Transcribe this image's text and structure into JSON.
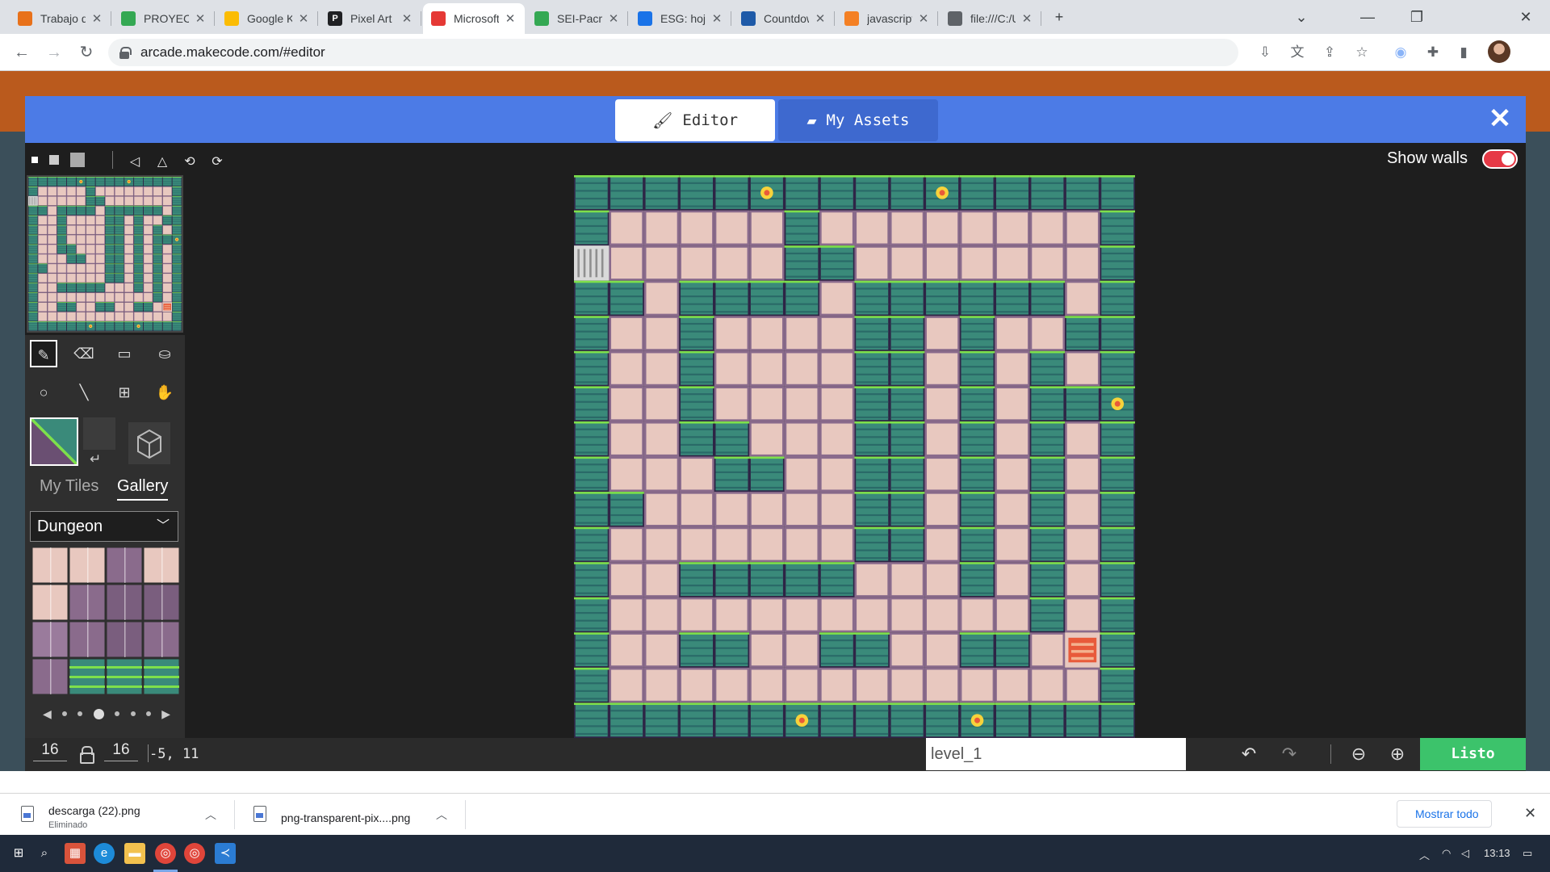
{
  "browser": {
    "tabs": [
      {
        "title": "Trabajo de cl",
        "color": "#e8711a",
        "glyph": "",
        "active": false
      },
      {
        "title": "PROYECTO -",
        "color": "#34a853",
        "glyph": "",
        "active": false
      },
      {
        "title": "Google Keep",
        "color": "#fbbc04",
        "glyph": "",
        "active": false
      },
      {
        "title": "Pixel Art Mak",
        "color": "#202124",
        "glyph": "P",
        "active": false
      },
      {
        "title": "Microsoft Ma",
        "color": "#e53935",
        "glyph": "",
        "active": true
      },
      {
        "title": "SEI-Pacman-",
        "color": "#34a853",
        "glyph": "",
        "active": false
      },
      {
        "title": "ESG: hoja de",
        "color": "#1a73e8",
        "glyph": "",
        "active": false
      },
      {
        "title": "Countdown J",
        "color": "#1e5aa8",
        "glyph": "",
        "active": false
      },
      {
        "title": "javascript - R",
        "color": "#f48024",
        "glyph": "",
        "active": false
      },
      {
        "title": "file:///C:/Use",
        "color": "#5f6368",
        "glyph": "",
        "active": false
      }
    ],
    "new_tab": "+",
    "url": "arcade.makecode.com/#editor"
  },
  "modal": {
    "tabs": {
      "editor": "Editor",
      "assets": "My Assets"
    },
    "show_walls_label": "Show walls",
    "show_walls_on": true
  },
  "sidebar": {
    "tile_tabs": {
      "mine": "My Tiles",
      "gallery": "Gallery"
    },
    "category": "Dungeon"
  },
  "bottom": {
    "width": "16",
    "height": "16",
    "cursor": "-5, 11",
    "tilemap_name": "level_1",
    "done_label": "Listo"
  },
  "downloads": {
    "items": [
      {
        "name": "descarga (22).png",
        "status": "Eliminado"
      },
      {
        "name": "png-transparent-pix....png",
        "status": ""
      }
    ],
    "show_all": "Mostrar todo"
  },
  "taskbar": {
    "time": "13:13"
  },
  "colors": {
    "modal_header": "#4c7be6",
    "done_button": "#3cc36b",
    "wall": "#3a8a7a",
    "wall_edge": "#7ee04b",
    "floor": "#e8c8bf",
    "toggle": "#e63946"
  }
}
